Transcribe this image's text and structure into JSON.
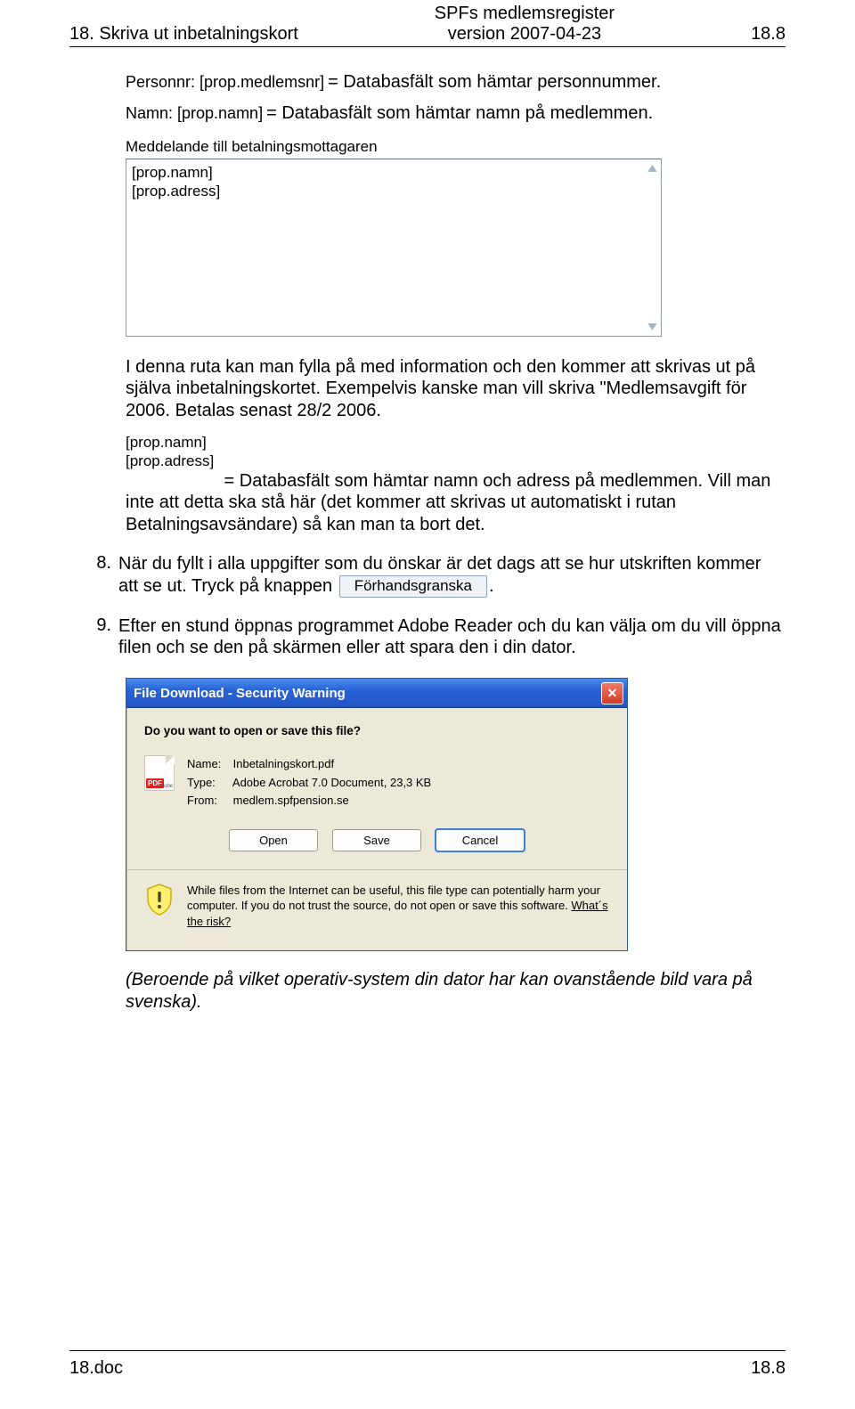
{
  "header": {
    "left": "18. Skriva ut inbetalningskort",
    "center_line1": "SPFs medlemsregister",
    "center_line2": "version 2007-04-23",
    "right": "18.8"
  },
  "field_personnr": {
    "label": "Personnr: [prop.medlemsnr]",
    "desc": " = Databasfält som hämtar personnummer."
  },
  "field_namn": {
    "label": "Namn: [prop.namn]",
    "desc": " = Databasfält som hämtar namn på medlemmen."
  },
  "msg": {
    "label": "Meddelande till betalningsmottagaren",
    "line1": "[prop.namn]",
    "line2": "[prop.adress]"
  },
  "para_ruta": "I denna ruta kan man fylla på med information och den kommer att skrivas ut på själva inbetalningskortet. Exempelvis kanske man vill skriva \"Medlemsavgift för 2006. Betalas senast 28/2 2006.",
  "field_dbl": {
    "line1": "[prop.namn]",
    "line2": "[prop.adress]"
  },
  "para_dbl": " = Databasfält som hämtar namn och adress på medlemmen. Vill man inte att detta ska stå här (det kommer att skrivas ut automatiskt i rutan Betalningsavsändare) så kan man ta bort det.",
  "step8": {
    "num": "8.",
    "text1": "När du fyllt i alla uppgifter som du önskar är det dags att se hur utskriften kommer att se ut. Tryck på knappen ",
    "button": "Förhandsgranska",
    "text2": "."
  },
  "step9": {
    "num": "9.",
    "text": "Efter en stund öppnas programmet Adobe Reader och du kan välja om du vill öppna filen och se den på skärmen eller att spara den i din dator."
  },
  "dialog": {
    "title": "File Download - Security Warning",
    "question": "Do you want to open or save this file?",
    "name_label": "Name:",
    "name_value": "Inbetalningskort.pdf",
    "type_label": "Type:",
    "type_value": "Adobe Acrobat 7.0 Document, 23,3 KB",
    "from_label": "From:",
    "from_value": "medlem.spfpension.se",
    "pdf_badge": "PDF",
    "pdf_brand": "Adobe",
    "btn_open": "Open",
    "btn_save": "Save",
    "btn_cancel": "Cancel",
    "warn_text": "While files from the Internet can be useful, this file type can potentially harm your computer. If you do not trust the source, do not open or save this software. ",
    "warn_link": "What´s the risk?"
  },
  "caption": "(Beroende på vilket operativ-system din dator har kan ovanstående bild vara på svenska).",
  "footer": {
    "left": "18.doc",
    "right": "18.8"
  }
}
